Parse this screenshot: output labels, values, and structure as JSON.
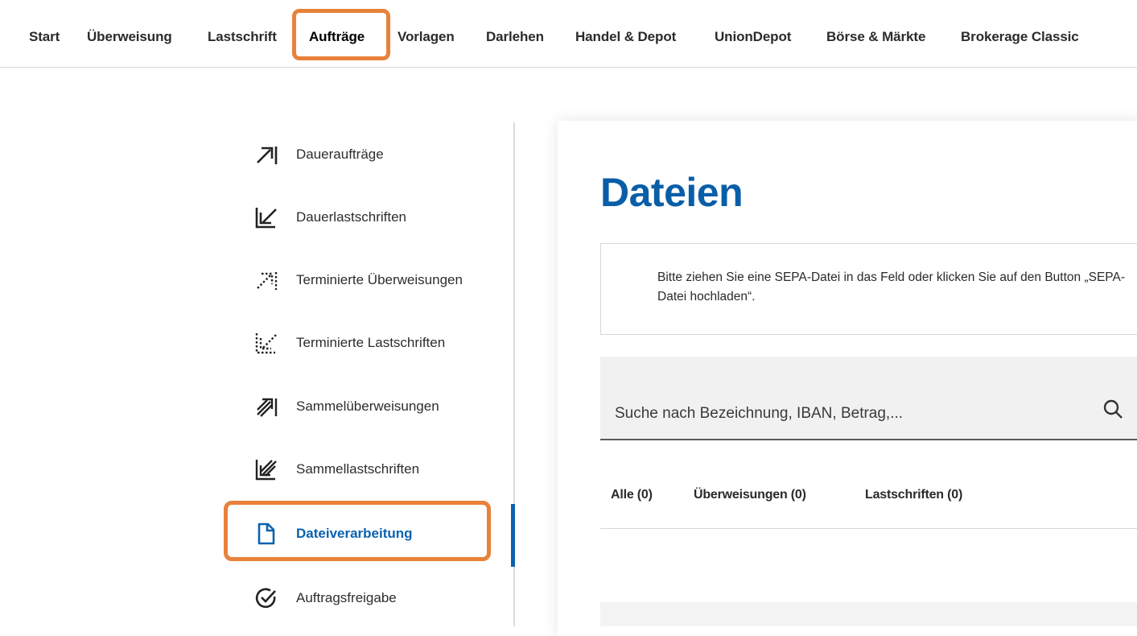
{
  "nav": {
    "items": [
      "Start",
      "Überweisung",
      "Lastschrift",
      "Aufträge",
      "Vorlagen",
      "Darlehen",
      "Handel & Depot",
      "UnionDepot",
      "Börse & Märkte",
      "Brokerage Classic"
    ],
    "active": "Aufträge"
  },
  "sidemenu": {
    "items": [
      {
        "label": "Daueraufträge",
        "icon": "arrow-up-right-icon"
      },
      {
        "label": "Dauerlastschriften",
        "icon": "arrow-down-left-icon"
      },
      {
        "label": "Terminierte Überweisungen",
        "icon": "dotted-arrow-up-right-icon"
      },
      {
        "label": "Terminierte Lastschriften",
        "icon": "dotted-arrow-down-left-icon"
      },
      {
        "label": "Sammelüberweisungen",
        "icon": "multi-arrow-up-right-icon"
      },
      {
        "label": "Sammellastschriften",
        "icon": "multi-arrow-down-left-icon"
      },
      {
        "label": "Dateiverarbeitung",
        "icon": "file-icon"
      },
      {
        "label": "Auftragsfreigabe",
        "icon": "check-circle-icon"
      }
    ],
    "active": "Dateiverarbeitung"
  },
  "main": {
    "title": "Dateien",
    "dropzone_text": "Bitte ziehen Sie eine SEPA-Datei in das Feld oder klicken Sie auf den Button „SEPA-Datei hochladen“.",
    "search_placeholder": "Suche nach Bezeichnung, IBAN, Betrag,...",
    "filters": [
      "Alle (0)",
      "Überweisungen (0)",
      "Lastschriften (0)"
    ]
  },
  "colors": {
    "accent": "#0b62b0",
    "highlight": "#e8823a"
  }
}
